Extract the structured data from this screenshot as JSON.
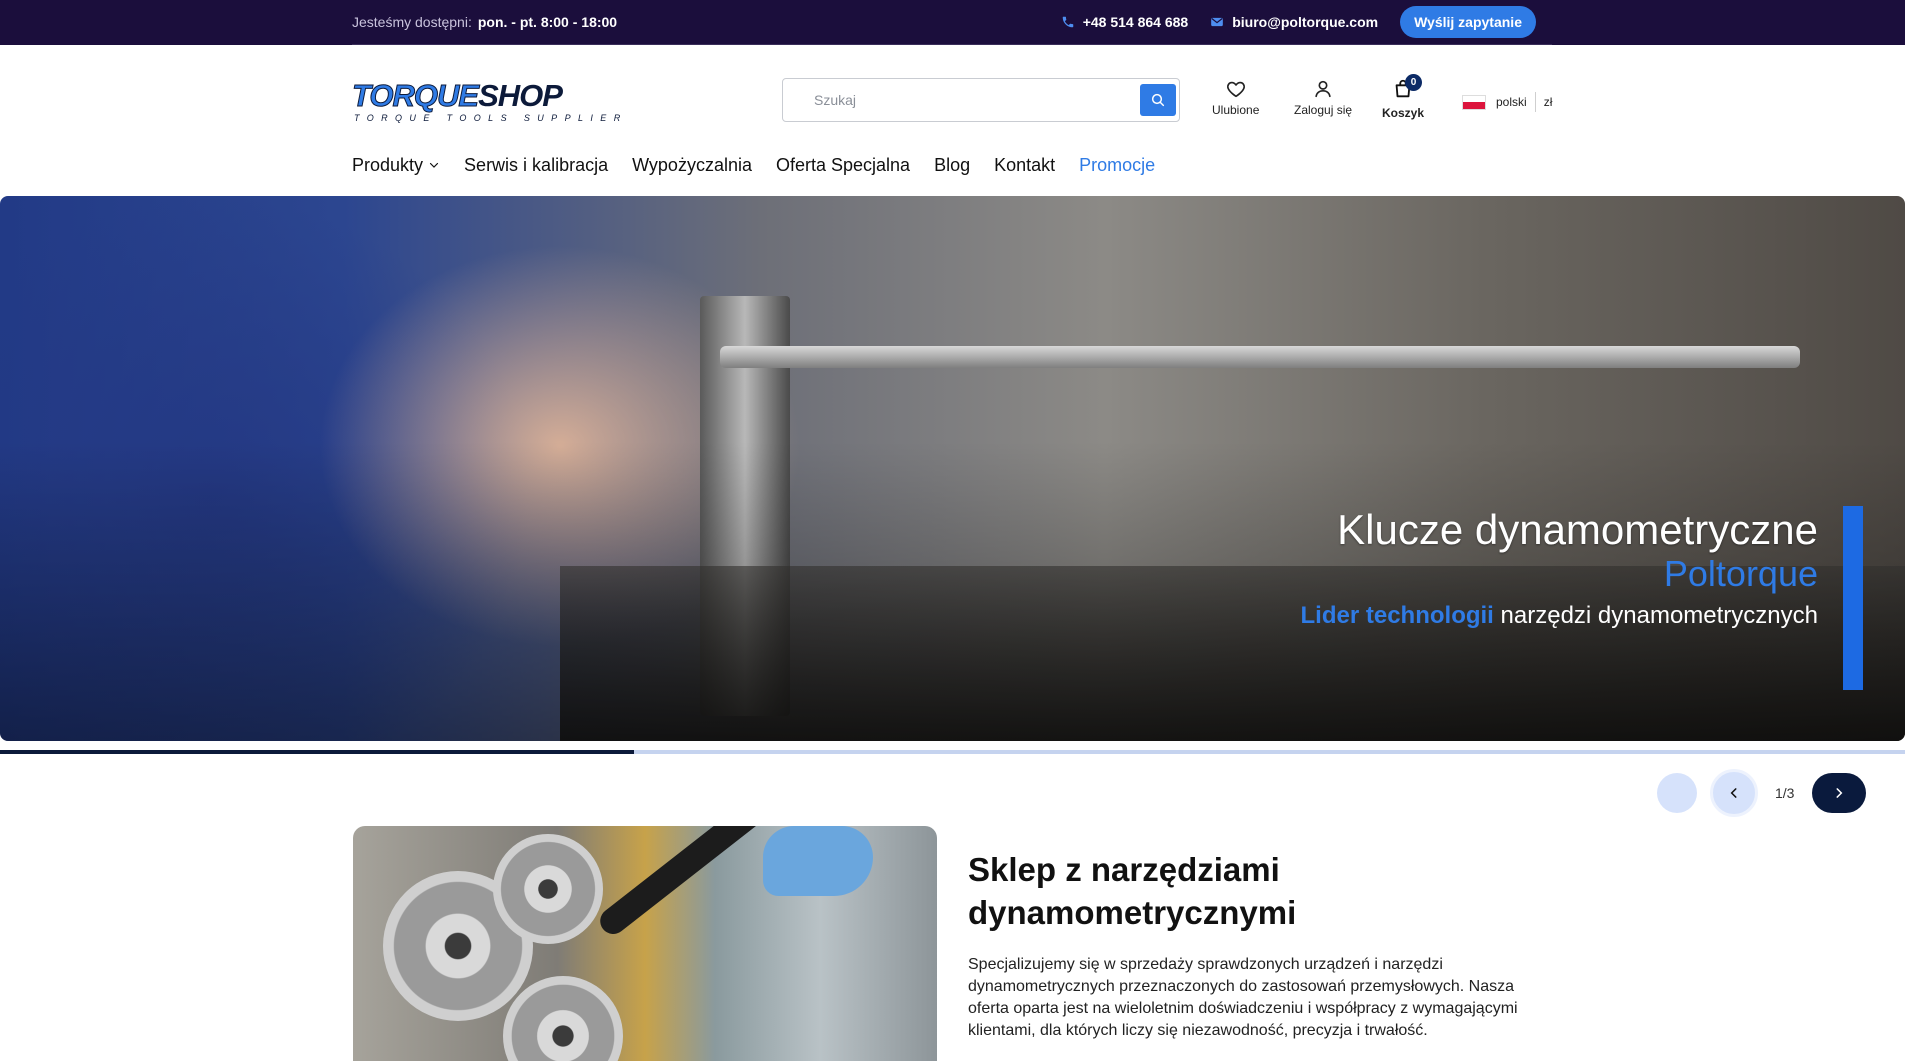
{
  "topbar": {
    "availability_label": "Jesteśmy dostępni:",
    "availability_hours": "pon. - pt. 8:00 - 18:00",
    "phone": "+48 514 864 688",
    "email": "biuro@poltorque.com",
    "inquiry_button": "Wyślij zapytanie"
  },
  "header": {
    "logo_part1": "TORQUE",
    "logo_part2": "SHOP",
    "logo_tagline": "TORQUE TOOLS SUPPLIER",
    "search_placeholder": "Szukaj",
    "favorites_label": "Ulubione",
    "login_label": "Zaloguj się",
    "cart_label": "Koszyk",
    "cart_count": "0",
    "language": "polski",
    "currency": "zł"
  },
  "nav": {
    "items": [
      {
        "label": "Produkty"
      },
      {
        "label": "Serwis i kalibracja"
      },
      {
        "label": "Wypożyczalnia"
      },
      {
        "label": "Oferta Specjalna"
      },
      {
        "label": "Blog"
      },
      {
        "label": "Kontakt"
      },
      {
        "label": "Promocje"
      }
    ]
  },
  "hero": {
    "title": "Klucze dynamometryczne",
    "brand": "Poltorque",
    "subtitle_strong": "Lider technologii",
    "subtitle_rest": " narzędzi dynamometrycznych"
  },
  "slider": {
    "counter": "1/3",
    "progress": 0.333
  },
  "intro": {
    "title": "Sklep z narzędziami dynamometrycznymi",
    "text": "Specjalizujemy się w sprzedaży sprawdzonych urządzeń i narzędzi dynamometrycznych przeznaczonych do zastosowań przemysłowych. Nasza oferta oparta jest na wieloletnim doświadczeniu i współpracy z wymagającymi klientami, dla których liczy się niezawodność, precyzja i trwałość."
  },
  "colors": {
    "topbar_bg": "#1b0e3c",
    "accent": "#2f7be5",
    "navy": "#0c1a3a"
  }
}
